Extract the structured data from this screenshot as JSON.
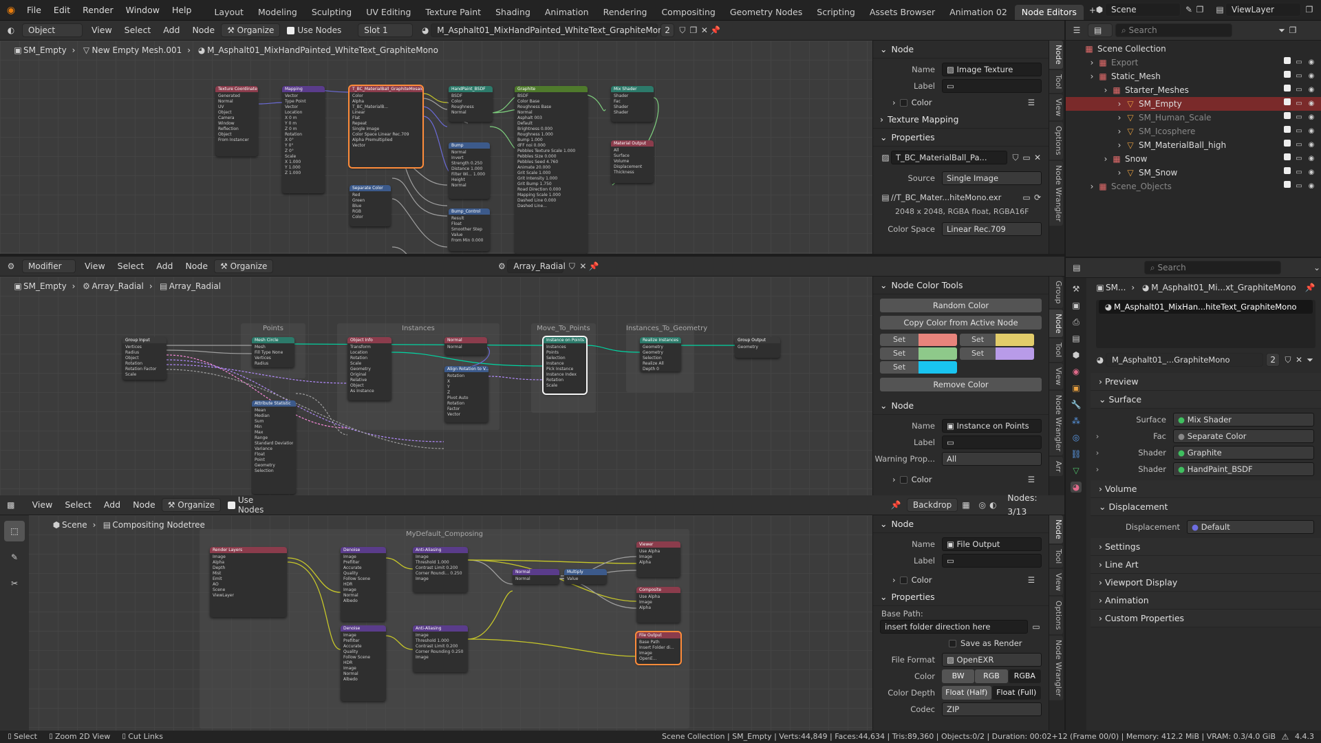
{
  "menu": {
    "items": [
      "File",
      "Edit",
      "Render",
      "Window",
      "Help"
    ]
  },
  "workspaces": {
    "tabs": [
      "Layout",
      "Modeling",
      "Sculpting",
      "UV Editing",
      "Texture Paint",
      "Shading",
      "Animation",
      "Rendering",
      "Compositing",
      "Geometry Nodes",
      "Scripting",
      "Assets Browser",
      "Animation 02",
      "Node Editors"
    ],
    "active": "Node Editors"
  },
  "topright": {
    "scene": "Scene",
    "viewlayer": "ViewLayer"
  },
  "shader_editor": {
    "header": {
      "mode": "Object",
      "menus": [
        "View",
        "Select",
        "Add",
        "Node"
      ],
      "organize": "Organize",
      "use_nodes": "Use Nodes",
      "slot": "Slot 1",
      "material": "M_Asphalt01_MixHandPainted_WhiteText_GraphiteMono",
      "users": "2"
    },
    "breadcrumb": [
      "SM_Empty",
      "New Empty Mesh.001",
      "M_Asphalt01_MixHandPainted_WhiteText_GraphiteMono"
    ],
    "nodes": [
      {
        "title": "Texture Coordinate",
        "color": "#8b3c4c",
        "rows": [
          "Generated",
          "Normal",
          "UV",
          "Object",
          "Camera",
          "Window",
          "Reflection",
          "Object",
          "From Instancer"
        ]
      },
      {
        "title": "Mapping",
        "color": "#5a3c8b",
        "rows": [
          "Vector",
          "Type Point",
          "Vector",
          "Location",
          "X 0 m",
          "Y 0 m",
          "Z 0 m",
          "Rotation",
          "X 0°",
          "Y 0°",
          "Z 0°",
          "Scale",
          "X 1.000",
          "Y 1.000",
          "Z 1.000"
        ]
      },
      {
        "title": "T_BC_MaterialBall_GraphiteMosaic",
        "color": "#8b3c4c",
        "rows": [
          "Color",
          "Alpha",
          "T_BC_MaterialB...",
          "Linear",
          "Flat",
          "Repeat",
          "Single Image",
          "Color Space Linear Rec.709",
          "Alpha Premultiplied",
          "Vector"
        ]
      },
      {
        "title": "HandPaint_BSDF",
        "color": "#2c7a6a",
        "rows": [
          "BSDF",
          "Color",
          "Roughness",
          "Normal"
        ]
      },
      {
        "title": "Bump",
        "color": "#3c5a8b",
        "rows": [
          "Normal",
          "Invert",
          "Strength 0.250",
          "Distance 1.000",
          "Filter Wi... 1.000",
          "Height",
          "Normal"
        ]
      },
      {
        "title": "Separate Color",
        "color": "#3c5a8b",
        "rows": [
          "Red",
          "Green",
          "Blue",
          "RGB",
          "Color"
        ]
      },
      {
        "title": "Bump_Control",
        "color": "#3c5a8b",
        "rows": [
          "Result",
          "Float",
          "Smoother Step",
          "Value",
          "From Min 0.000"
        ]
      },
      {
        "title": "Graphite",
        "color": "#4f7a2c",
        "rows": [
          "BSDF",
          "Color Base",
          "Roughness Base",
          "Normal",
          "Asphalt 003",
          "Default",
          "Brightness 0.000",
          "Roughness 1.000",
          "Bump 1.000",
          "dFF noi 0.000",
          "Pebbles Texture Scale 1.000",
          "Pebbles Size 0.000",
          "Pebbles Seed 4.760",
          "Animate 20.000",
          "Grit Scale 1.000",
          "Grit Intensity 1.000",
          "Grit Bump 1.750",
          "Road Direction 0.000",
          "Mapping Scale 1.000",
          "Dashed Line 0.000",
          "Dashed Line..."
        ]
      },
      {
        "title": "Mix Shader",
        "color": "#2c7a6a",
        "rows": [
          "Shader",
          "Fac",
          "Shader",
          "Shader"
        ]
      },
      {
        "title": "Material Output",
        "color": "#8b3c4c",
        "rows": [
          "All",
          "Surface",
          "Volume",
          "Displacement",
          "Thickness"
        ]
      }
    ]
  },
  "shader_sidebar": {
    "tabs": [
      "Node",
      "Tool",
      "View",
      "Options",
      "Node Wrangler"
    ],
    "node": {
      "title": "Node",
      "name_label": "Name",
      "name": "Image Texture",
      "label_label": "Label",
      "label": "",
      "color_label": "Color"
    },
    "texture_mapping": "Texture Mapping",
    "properties": {
      "title": "Properties",
      "image": "T_BC_MaterialBall_Pa...",
      "source_label": "Source",
      "source": "Single Image",
      "filepath": "//T_BC_Mater...hiteMono.exr",
      "info": "2048 x 2048,  RGBA float,  RGBA16F",
      "colorspace_label": "Color Space",
      "colorspace": "Linear Rec.709"
    }
  },
  "geo_editor": {
    "header": {
      "mode": "Modifier",
      "menus": [
        "View",
        "Select",
        "Add",
        "Node"
      ],
      "organize": "Organize",
      "tree": "Array_Radial"
    },
    "breadcrumb": [
      "SM_Empty",
      "Array_Radial",
      "Array_Radial"
    ],
    "frames": [
      "Points",
      "Instances",
      "Move_To_Points",
      "Instances_To_Geometry"
    ],
    "nodes": [
      {
        "title": "Group Input",
        "color": "#3a3a3a",
        "rows": [
          "Vertices",
          "Radius",
          "Object",
          "Rotation",
          "Rotation Factor",
          "Scale"
        ]
      },
      {
        "title": "Mesh Circle",
        "color": "#2c7a6a",
        "rows": [
          "Mesh",
          "Fill Type None",
          "Vertices",
          "Radius"
        ]
      },
      {
        "title": "Object Info",
        "color": "#8b3c4c",
        "rows": [
          "Transform",
          "Location",
          "Rotation",
          "Scale",
          "Geometry",
          "Original",
          "Relative",
          "Object",
          "As Instance"
        ]
      },
      {
        "title": "Normal",
        "color": "#8b3c4c",
        "rows": [
          "Normal"
        ]
      },
      {
        "title": "Align Rotation to V...",
        "color": "#3c5a8b",
        "rows": [
          "Rotation",
          "X",
          "Y",
          "Z",
          "Pivot Auto",
          "Rotation",
          "Factor",
          "Vector"
        ]
      },
      {
        "title": "Instance on Points",
        "color": "#2c7a6a",
        "rows": [
          "Instances",
          "Points",
          "Selection",
          "Instance",
          "Pick Instance",
          "Instance Index",
          "Rotation",
          "Scale"
        ]
      },
      {
        "title": "Realize Instances",
        "color": "#2c7a6a",
        "rows": [
          "Geometry",
          "Geometry",
          "Selection",
          "Realize All",
          "Depth 0"
        ]
      },
      {
        "title": "Group Output",
        "color": "#3a3a3a",
        "rows": [
          "Geometry"
        ]
      },
      {
        "title": "Attribute Statistic",
        "color": "#3c5a8b",
        "rows": [
          "Mean",
          "Median",
          "Sum",
          "Min",
          "Max",
          "Range",
          "Standard Deviation",
          "Variance",
          "Float",
          "Point",
          "Geometry",
          "Selection"
        ]
      }
    ]
  },
  "geo_sidebar": {
    "tabs": [
      "Group",
      "Node",
      "Tool",
      "View",
      "Node Wrangler",
      "Arr"
    ],
    "color_tools": {
      "title": "Node Color Tools",
      "random": "Random Color",
      "copy": "Copy Color from Active Node",
      "set": "Set",
      "remove": "Remove Color",
      "swatches": [
        "#e8847c",
        "#e2cc6a",
        "#8ec98a",
        "#b89be8",
        "#19c4f0"
      ]
    },
    "node": {
      "title": "Node",
      "name_label": "Name",
      "name": "Instance on Points",
      "label_label": "Label",
      "label": "",
      "warning_label": "Warning Prop...",
      "warning": "All",
      "color_label": "Color"
    }
  },
  "comp_editor": {
    "header": {
      "menus": [
        "View",
        "Select",
        "Add",
        "Node"
      ],
      "organize": "Organize",
      "use_nodes": "Use Nodes",
      "backdrop": "Backdrop",
      "nodes_count": "Nodes: 3/13"
    },
    "breadcrumb": [
      "Scene",
      "Compositing Nodetree"
    ],
    "frame": "MyDefault_Composing",
    "nodes": [
      {
        "title": "Render Layers",
        "color": "#8b3c4c",
        "rows": [
          "Image",
          "Alpha",
          "Depth",
          "Mist",
          "Emit",
          "AO",
          "Scene",
          "ViewLayer"
        ]
      },
      {
        "title": "Denoise",
        "color": "#5a3c8b",
        "rows": [
          "Image",
          "Prefilter",
          "Accurate",
          "Quality",
          "Follow Scene",
          "HDR",
          "Image",
          "Normal",
          "Albedo"
        ]
      },
      {
        "title": "Anti-Aliasing",
        "color": "#5a3c8b",
        "rows": [
          "Image",
          "Threshold 1.000",
          "Contrast Limit 0.200",
          "Corner Roundi... 0.250",
          "Image"
        ]
      },
      {
        "title": "Normal",
        "color": "#5a3c8b",
        "rows": [
          "Normal"
        ]
      },
      {
        "title": "Multiply",
        "color": "#3c5a8b",
        "rows": [
          "Value"
        ]
      },
      {
        "title": "Viewer",
        "color": "#8b3c4c",
        "rows": [
          "Use Alpha",
          "Image",
          "Alpha"
        ]
      },
      {
        "title": "Composite",
        "color": "#8b3c4c",
        "rows": [
          "Use Alpha",
          "Image",
          "Alpha"
        ]
      },
      {
        "title": "Denoise",
        "color": "#5a3c8b",
        "rows": [
          "Image",
          "Prefilter",
          "Accurate",
          "Quality",
          "Follow Scene",
          "HDR",
          "Image",
          "Normal",
          "Albedo"
        ]
      },
      {
        "title": "Anti-Aliasing",
        "color": "#5a3c8b",
        "rows": [
          "Image",
          "Threshold 1.000",
          "Contrast Limit 0.200",
          "Corner Rounding 0.250",
          "Image"
        ]
      },
      {
        "title": "File Output",
        "color": "#8b3c4c",
        "rows": [
          "Base Path",
          "Insert Folder di...",
          "Image",
          "OpenE..."
        ]
      }
    ]
  },
  "comp_sidebar": {
    "tabs": [
      "Node",
      "Tool",
      "View",
      "Options",
      "Node Wrangler"
    ],
    "node": {
      "title": "Node",
      "name_label": "Name",
      "name": "File Output",
      "label_label": "Label",
      "label": "",
      "color_label": "Color"
    },
    "properties": {
      "title": "Properties",
      "basepath_label": "Base Path:",
      "basepath": "insert folder direction here",
      "save_as_render": "Save as Render",
      "format_label": "File Format",
      "format": "OpenEXR",
      "color_label": "Color",
      "color_opts": [
        "BW",
        "RGB",
        "RGBA"
      ],
      "depth_label": "Color Depth",
      "depth_opts": [
        "Float (Half)",
        "Float (Full)"
      ],
      "codec_label": "Codec",
      "codec": "ZIP"
    }
  },
  "outliner": {
    "search_placeholder": "Search",
    "rows": [
      {
        "label": "Scene Collection",
        "indent": 0
      },
      {
        "label": "Export",
        "indent": 1
      },
      {
        "label": "Static_Mesh",
        "indent": 1
      },
      {
        "label": "Starter_Meshes",
        "indent": 2
      },
      {
        "label": "SM_Empty",
        "indent": 3
      },
      {
        "label": "SM_Human_Scale",
        "indent": 3
      },
      {
        "label": "SM_Icosphere",
        "indent": 3
      },
      {
        "label": "SM_MaterialBall_high",
        "indent": 3
      },
      {
        "label": "Snow",
        "indent": 2
      },
      {
        "label": "SM_Snow",
        "indent": 3
      },
      {
        "label": "Scene_Objects",
        "indent": 1
      }
    ],
    "selected": "SM_Empty"
  },
  "properties_editor": {
    "search_placeholder": "Search",
    "breadcrumb": [
      "SM...",
      "M_Asphalt01_Mi...xt_GraphiteMono"
    ],
    "slot": "M_Asphalt01_MixHan...hiteText_GraphiteMono",
    "material": "M_Asphalt01_...GraphiteMono",
    "users": "2",
    "sections": {
      "preview": "Preview",
      "surface": "Surface",
      "volume": "Volume",
      "displacement": "Displacement",
      "settings": "Settings",
      "lineart": "Line Art",
      "viewport": "Viewport Display",
      "animation": "Animation",
      "custom": "Custom Properties"
    },
    "surface_rows": [
      {
        "label": "Surface",
        "value": "Mix Shader",
        "color": "#3fbf5f"
      },
      {
        "label": "Fac",
        "value": "Separate Color",
        "color": "#888"
      },
      {
        "label": "Shader",
        "value": "Graphite",
        "color": "#3fbf5f"
      },
      {
        "label": "Shader",
        "value": "HandPaint_BSDF",
        "color": "#3fbf5f"
      }
    ],
    "displacement_row": {
      "label": "Displacement",
      "value": "Default",
      "color": "#6d6de0"
    }
  },
  "statusbar": {
    "left": [
      "Select",
      "Zoom 2D View",
      "Cut Links"
    ],
    "right": "Scene Collection | SM_Empty | Verts:44,849 | Faces:44,634 | Tris:89,360 | Objects:0/2 | Duration: 00:02+12 (Frame 00/0) | Memory: 412.2 MiB | VRAM: 0.3/4.0 GiB",
    "version": "4.4.3"
  }
}
